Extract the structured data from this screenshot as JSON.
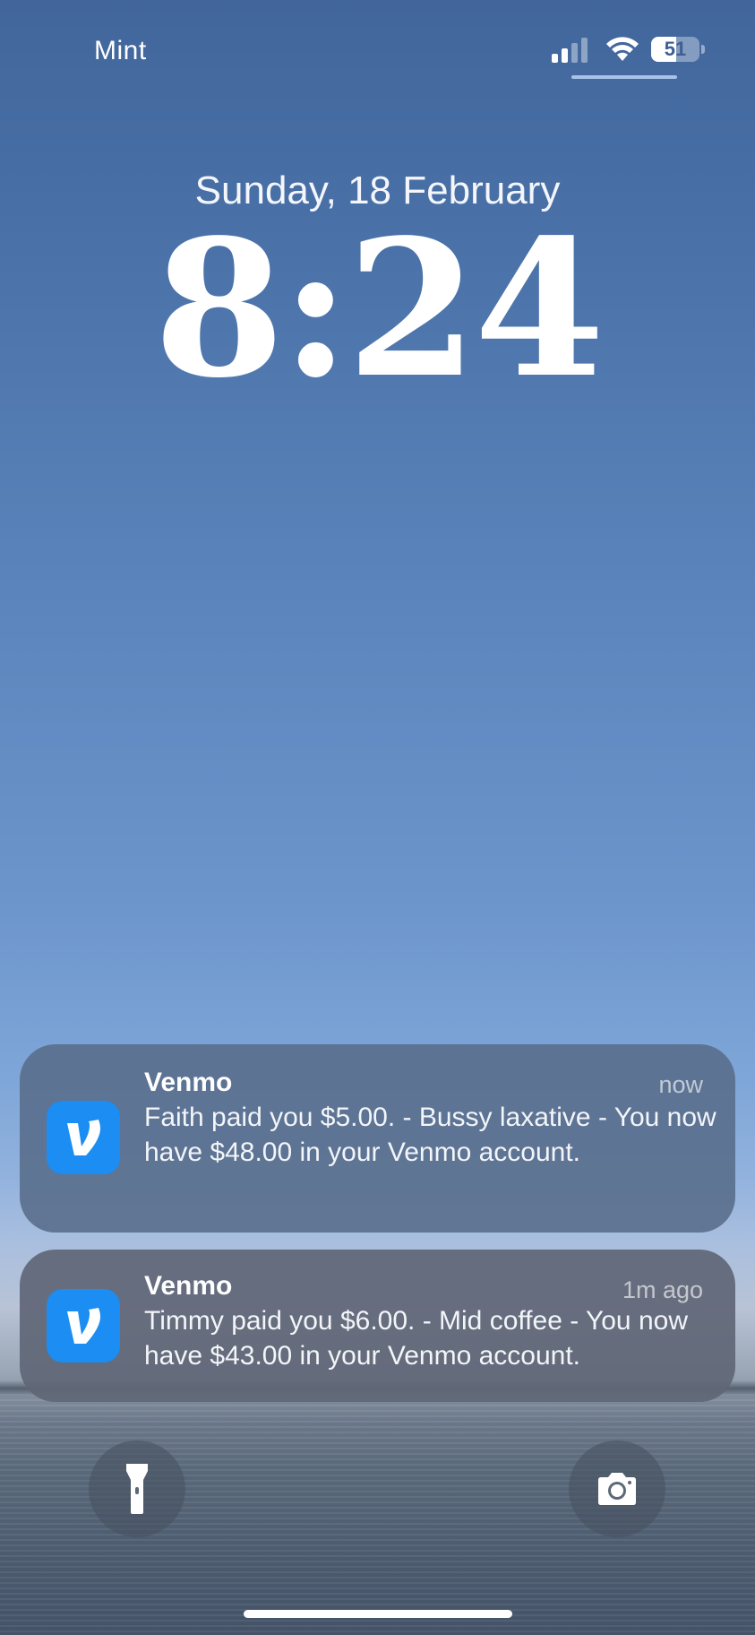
{
  "status_bar": {
    "carrier": "Mint",
    "signal_icon": "cellular-signal-icon",
    "wifi_icon": "wifi-icon",
    "battery_level": "51",
    "battery_fraction": 0.51
  },
  "lock_screen": {
    "date": "Sunday, 18 February",
    "time": "8:24"
  },
  "notifications": [
    {
      "app": "Venmo",
      "time": "now",
      "icon": "venmo-app-icon",
      "body": "Faith paid you $5.00. - Bussy laxative - You now have $48.00 in your Venmo account."
    },
    {
      "app": "Venmo",
      "time": "1m ago",
      "icon": "venmo-app-icon",
      "body": "Timmy paid you $6.00. - Mid coffee - You now have $43.00 in your Venmo account."
    }
  ],
  "quick_actions": {
    "left": "flashlight-icon",
    "right": "camera-icon"
  },
  "colors": {
    "venmo_blue": "#1c8df2",
    "sky_top": "#41669c",
    "sky_mid": "#7ea6d8"
  }
}
